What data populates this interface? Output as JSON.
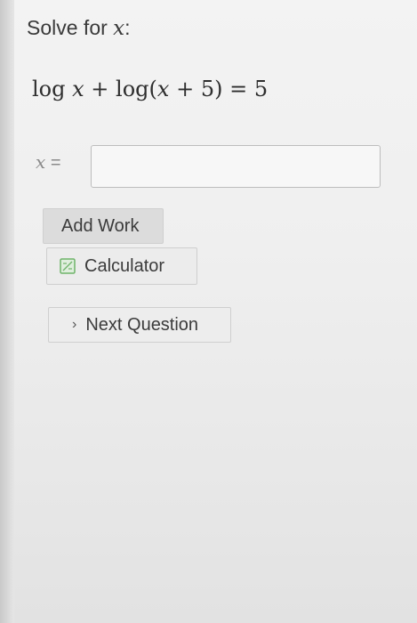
{
  "question": {
    "prompt_prefix": "Solve for ",
    "prompt_var": "x",
    "prompt_suffix": ":",
    "equation": {
      "log1": "log ",
      "var1": "x",
      "plus": " + ",
      "log2": "log(",
      "var2": "x",
      "rest": " + 5) = 5"
    }
  },
  "answer": {
    "label_var": "x",
    "label_eq": " =",
    "value": "",
    "placeholder": ""
  },
  "buttons": {
    "add_work": "Add Work",
    "calculator": "Calculator",
    "next_question": "Next Question"
  },
  "icons": {
    "calculator": "calculator-icon",
    "next": "chevron-right-icon"
  },
  "colors": {
    "background": "#ececec",
    "button_bg": "#e2e2e2",
    "input_border": "#bdbdbd",
    "calculator_icon": "#6fb36a"
  }
}
